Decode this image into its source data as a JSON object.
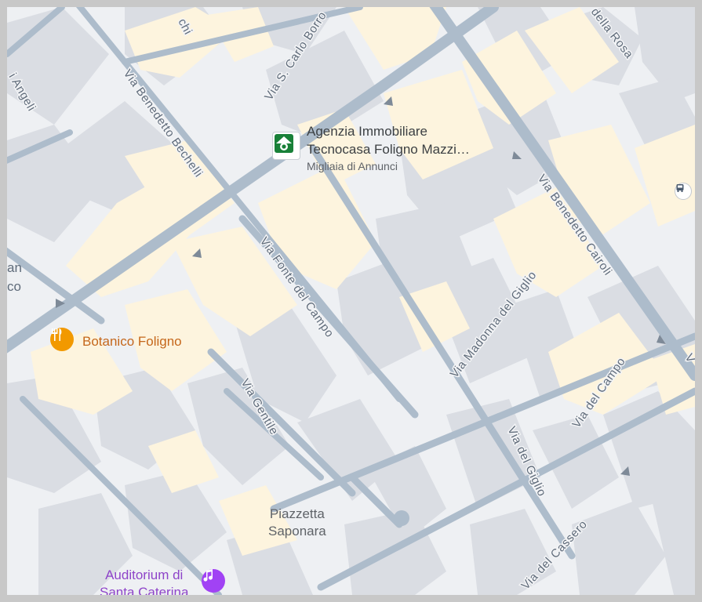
{
  "streets": {
    "ch": "chi",
    "via_s_carlo_borro": "Via S. Carlo Borro",
    "via_della_rosa": "della Rosa",
    "via_angeli": "i Angeli",
    "via_benedetto_bechelli": "Via Benedetto Bechelli",
    "via_benedetto_cairoli": "Via Benedetto Cairoli",
    "via_fonte_del_campo": "Via Fonte del Campo",
    "via_madonna_del_giglio": "Via Madonna del Giglio",
    "via_gentile": "Via Gentile",
    "via_del_campo": "Via del Campo",
    "via_del_giglio": "Via del Giglio",
    "via_del_cassero": "Via del Cassero",
    "via_v": "V",
    "an": "an",
    "co": "co"
  },
  "pois": {
    "agenzia": {
      "line1": "Agenzia Immobiliare",
      "line2": "Tecnocasa Foligno Mazzi…",
      "sub": "Migliaia di Annunci",
      "icon": "house-icon",
      "color": "#188038"
    },
    "botanico": {
      "name": "Botanico Foligno",
      "icon": "restaurant-icon",
      "color": "#f29900",
      "text_color": "#c5671b"
    },
    "piazzetta": {
      "line1": "Piazzetta",
      "line2": "Saponara"
    },
    "auditorium": {
      "line1": "Auditorium di",
      "line2": "Santa Caterina",
      "icon": "music-note-icon",
      "color": "#a142f4",
      "text_color": "#8e44c9"
    }
  },
  "colors": {
    "roads": "#adbccb",
    "buildings": "#dadde3",
    "highlighted_buildings": "#fdf4de",
    "background": "#eef0f3"
  }
}
